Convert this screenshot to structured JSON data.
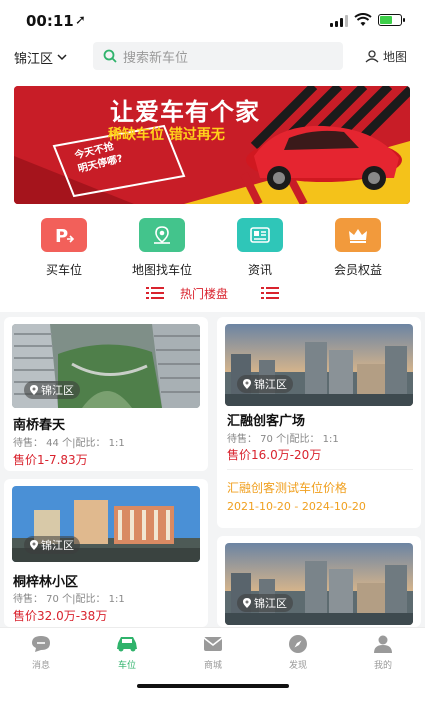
{
  "status": {
    "time": "00:11"
  },
  "topbar": {
    "city": "锦江区",
    "search_placeholder": "搜索新车位",
    "map_label": "地图"
  },
  "banner": {
    "title": "让爱车有个家",
    "subtitle": "稀缺车位  错过再无",
    "tag_line1": "今天不抢",
    "tag_line2": "明天停哪?"
  },
  "quick_links": [
    {
      "label": "买车位",
      "icon": "parking-icon",
      "color": "#f2605a"
    },
    {
      "label": "地图找车位",
      "icon": "map-pin-icon",
      "color": "#43c48c"
    },
    {
      "label": "资讯",
      "icon": "news-icon",
      "color": "#2fc6b8"
    },
    {
      "label": "会员权益",
      "icon": "crown-icon",
      "color": "#f29a3c"
    }
  ],
  "section": {
    "title": "热门楼盘"
  },
  "listings": [
    {
      "name": "南桥春天",
      "district": "锦江区",
      "stats": "待售： 44 个|配比： 1:1",
      "price": "售价1-7.83万"
    },
    {
      "name": "汇融创客广场",
      "district": "锦江区",
      "stats": "待售： 70 个|配比： 1:1",
      "price": "售价16.0万-20万",
      "promo": "汇融创客测试车位价格",
      "promo_dates": "2021-10-20 - 2024-10-20"
    },
    {
      "name": "桐梓林小区",
      "district": "锦江区",
      "stats": "待售： 70 个|配比： 1:1",
      "price": "售价32.0万-38万"
    },
    {
      "name": "",
      "district": "锦江区"
    }
  ],
  "tabbar": [
    {
      "label": "消息",
      "icon": "message-icon"
    },
    {
      "label": "车位",
      "icon": "car-icon",
      "active": true
    },
    {
      "label": "商城",
      "icon": "mail-icon"
    },
    {
      "label": "发现",
      "icon": "compass-icon"
    },
    {
      "label": "我的",
      "icon": "user-icon"
    }
  ],
  "colors": {
    "accent": "#2fb36b",
    "price_red": "#d9232e",
    "promo_orange": "#f0a020"
  }
}
